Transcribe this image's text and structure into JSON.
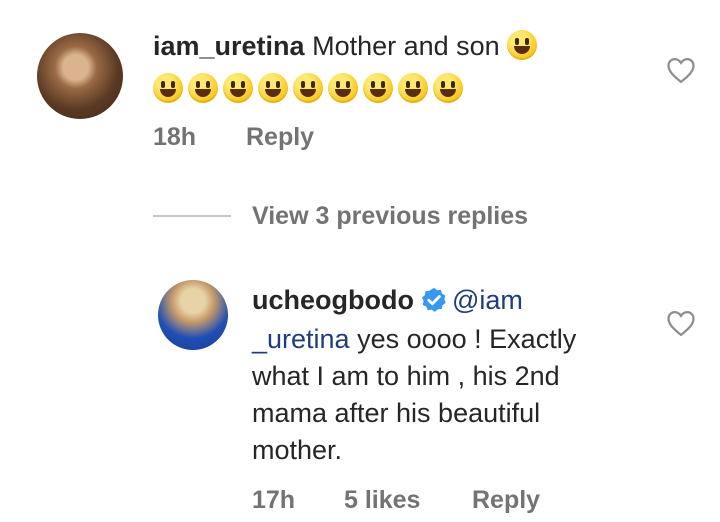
{
  "comment1": {
    "username": "iam_uretina",
    "text": "Mother and son",
    "emoji_count_line1": 1,
    "emoji_count_line2": 9,
    "time": "18h",
    "reply_label": "Reply"
  },
  "view_replies": "View 3 previous replies",
  "comment2": {
    "username": "ucheogbodo",
    "verified": true,
    "mention_part1": "@iam",
    "mention_part2": "_uretina",
    "line1_rest": " yes oooo ! Exactly",
    "line2": "what I am to him , his 2nd",
    "line3": "mama after his beautiful",
    "line4": "mother.",
    "time": "17h",
    "likes": "5 likes",
    "reply_label": "Reply"
  },
  "colors": {
    "mention": "#1f3d7a",
    "meta": "#737373",
    "verified": "#3897f0"
  },
  "icons": [
    "heart-icon",
    "verified-badge-icon",
    "smiling-face-emoji"
  ]
}
